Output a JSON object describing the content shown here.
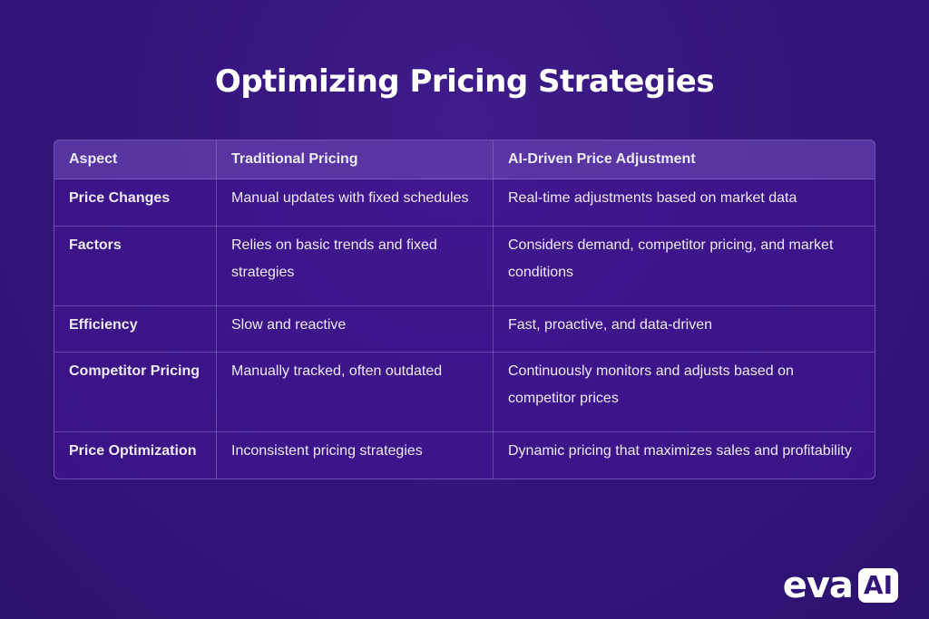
{
  "title": "Optimizing Pricing Strategies",
  "table": {
    "headers": [
      "Aspect",
      "Traditional Pricing",
      "AI-Driven Price Adjustment"
    ],
    "rows": [
      {
        "aspect": "Price Changes",
        "traditional": "Manual updates with fixed schedules",
        "ai": "Real-time adjustments based on market data"
      },
      {
        "aspect": "Factors",
        "traditional": "Relies on basic trends and fixed strategies",
        "ai": "Considers demand, competitor pricing, and market conditions"
      },
      {
        "aspect": "Efficiency",
        "traditional": "Slow and reactive",
        "ai": "Fast, proactive, and data-driven"
      },
      {
        "aspect": "Competitor Pricing",
        "traditional": "Manually tracked, often outdated",
        "ai": "Continuously monitors and adjusts based on competitor prices"
      },
      {
        "aspect": "Price Optimization",
        "traditional": "Inconsistent pricing strategies",
        "ai": "Dynamic pricing that maximizes sales and profitability"
      }
    ]
  },
  "logo": {
    "text": "eva",
    "badge": "AI"
  }
}
